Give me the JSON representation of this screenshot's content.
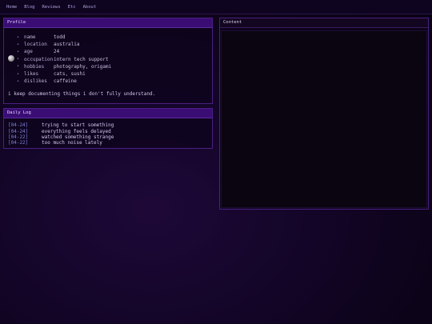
{
  "nav": [
    "Home",
    "Blog",
    "Reviews",
    "Etc",
    "About"
  ],
  "profile": {
    "title": "Profile",
    "rows": [
      {
        "key": "name",
        "value": "todd"
      },
      {
        "key": "location",
        "value": "australia"
      },
      {
        "key": "age",
        "value": "24"
      },
      {
        "key": "occupation",
        "value": "intern tech support"
      },
      {
        "key": "hobbies",
        "value": "photography, origami"
      },
      {
        "key": "likes",
        "value": "cats, sushi"
      },
      {
        "key": "dislikes",
        "value": "caffeine"
      }
    ],
    "quote": "i keep documenting things i don't fully understand."
  },
  "daily_log": {
    "title": "Daily Log",
    "entries": [
      {
        "date": "[04-24]",
        "text": "trying to start something"
      },
      {
        "date": "[04-24]",
        "text": "everything feels delayed"
      },
      {
        "date": "[04-22]",
        "text": "watched something strange"
      },
      {
        "date": "[04-22]",
        "text": "too much noise lately"
      }
    ]
  },
  "content": {
    "title": "Content"
  },
  "bullet_glyph": "•",
  "colors": {
    "accent": "#3a0d74",
    "border": "#4a1f80",
    "date": "#7f82d8"
  }
}
